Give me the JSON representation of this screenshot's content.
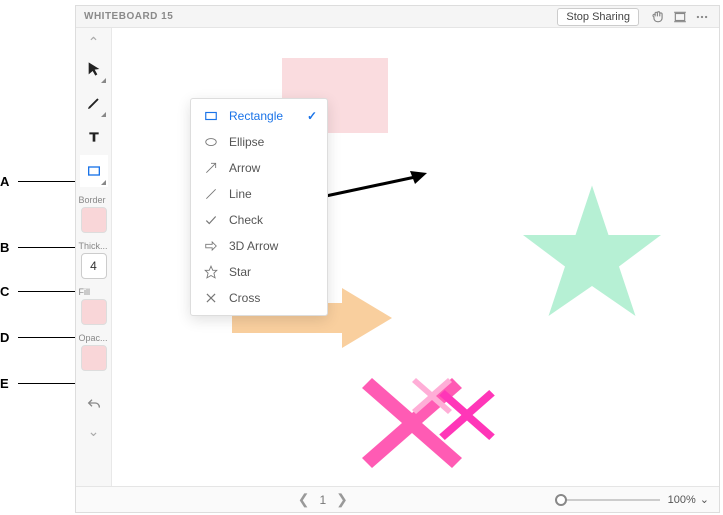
{
  "callouts": {
    "a": "A",
    "b": "B",
    "c": "C",
    "d": "D",
    "e": "E"
  },
  "header": {
    "title": "WHITEBOARD 15",
    "stop_sharing": "Stop Sharing"
  },
  "tools": {
    "thickness_value": "4",
    "labels": {
      "border": "Border",
      "thickness": "Thick...",
      "fill": "Fill",
      "opacity": "Opac..."
    }
  },
  "dropdown": {
    "items": [
      {
        "label": "Rectangle",
        "selected": true
      },
      {
        "label": "Ellipse",
        "selected": false
      },
      {
        "label": "Arrow",
        "selected": false
      },
      {
        "label": "Line",
        "selected": false
      },
      {
        "label": "Check",
        "selected": false
      },
      {
        "label": "3D Arrow",
        "selected": false
      },
      {
        "label": "Star",
        "selected": false
      },
      {
        "label": "Cross",
        "selected": false
      }
    ]
  },
  "footer": {
    "page": "1",
    "zoom": "100%"
  },
  "colors": {
    "pink": "#fadcdf",
    "mint": "#b6f0d4",
    "apricot": "#f9cf9e",
    "magenta": "#ff36b8",
    "lightpink": "#ffaed7",
    "hotpink": "#ff5bb4",
    "swatch": "#f9d6d8",
    "accent": "#1a73e8"
  }
}
